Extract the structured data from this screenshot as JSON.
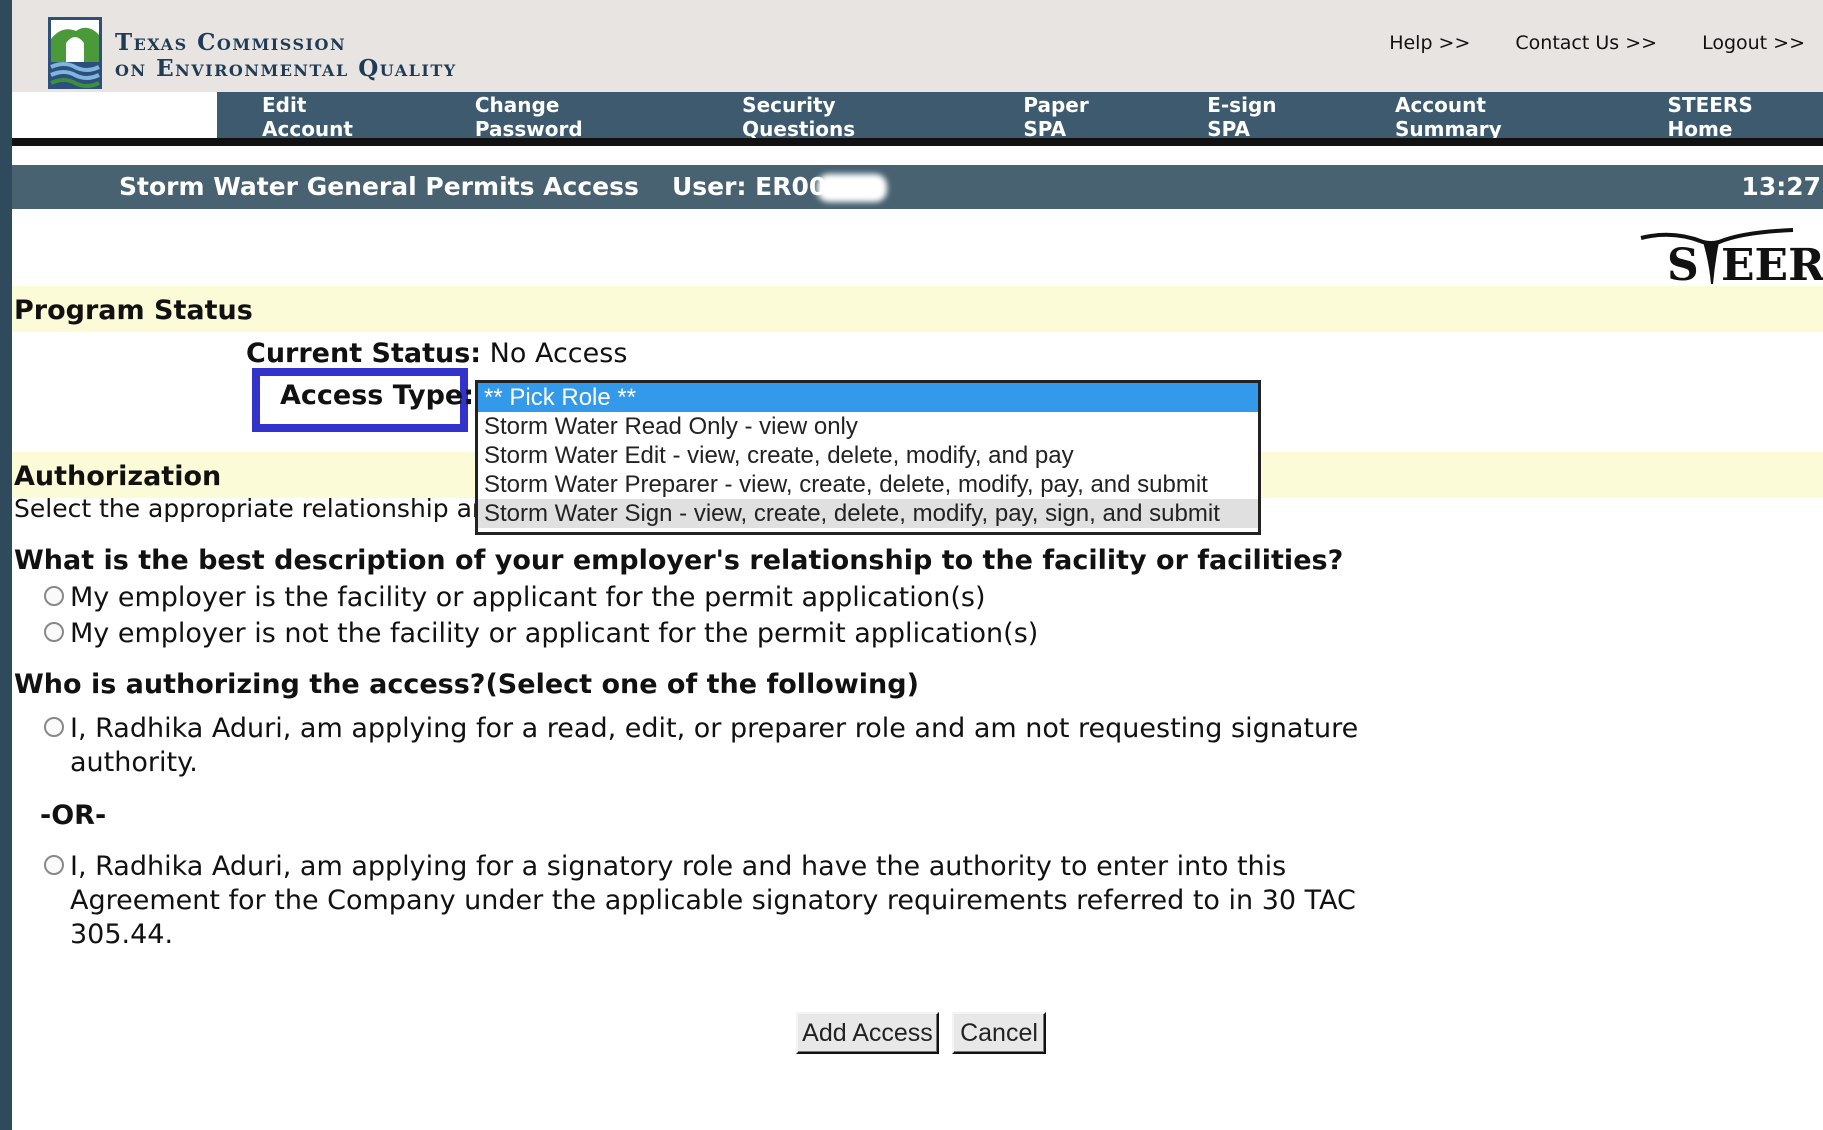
{
  "header": {
    "agency_line1": "Texas Commission",
    "agency_line2": "on Environmental Quality",
    "top_links": [
      "Help >>",
      "Contact Us >>",
      "Logout >>"
    ]
  },
  "nav": [
    "Edit Account",
    "Change Password",
    "Security Questions",
    "Paper SPA",
    "E-sign SPA",
    "Account Summary",
    "STEERS Home"
  ],
  "titlebar": {
    "app_title": "Storm Water General Permits Access",
    "user": "User: ER00",
    "clock": "13:27"
  },
  "logo": {
    "steers_text": "STEERS"
  },
  "program_status": {
    "heading": "Program Status",
    "current_status_label": "Current Status:",
    "current_status_value": "No Access",
    "access_type_label": "Access Type:"
  },
  "role_dropdown": {
    "options": [
      "** Pick Role **",
      "Storm Water Read Only - view only",
      "Storm Water Edit - view, create, delete, modify, and pay",
      "Storm Water Preparer - view, create, delete, modify, pay, and submit",
      "Storm Water Sign - view, create, delete, modify, pay, sign, and submit"
    ],
    "selected": "** Pick Role **"
  },
  "authorization": {
    "heading": "Authorization",
    "subtext": "Select the appropriate relationship and"
  },
  "q1": {
    "text": "What is the best description of your employer's relationship to the facility or facilities?",
    "options": [
      "My employer is the facility or applicant for the permit application(s)",
      "My employer is not the facility or applicant for the permit application(s)"
    ]
  },
  "q2": {
    "text": "Who is authorizing the access?(Select one of the following)",
    "option1_line1": "I, Radhika Aduri, am applying for a read, edit, or preparer role and am not requesting signature",
    "option1_line2": "authority.",
    "or_text": "-OR-",
    "option2_line1": "I, Radhika Aduri, am applying for a signatory role and have the authority to enter into this",
    "option2_line2": "Agreement for the Company under the applicable signatory requirements referred to in 30 TAC",
    "option2_line3": "305.44."
  },
  "buttons": {
    "add": "Add Access",
    "cancel": "Cancel"
  },
  "colors": {
    "nav_bg": "#3d5a6f",
    "titlebar_bg": "#486272",
    "section_band": "#fbfbd8",
    "highlight_box": "#3333cc",
    "selected_option": "#3399ea"
  }
}
